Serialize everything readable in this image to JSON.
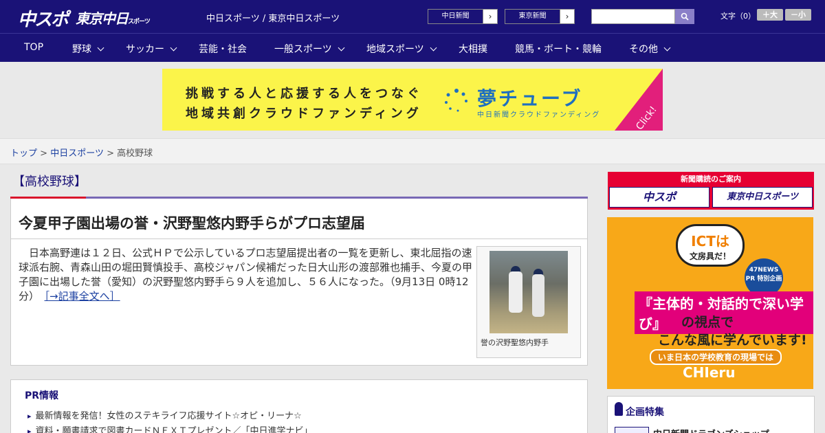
{
  "header": {
    "logo_chuspo": "中スポ",
    "logo_tokyo": "東京中日",
    "logo_tokyo_small": "スポーツ",
    "site_links": "中日スポーツ / 東京中日スポーツ",
    "paper_buttons": [
      "中日新聞",
      "東京新聞"
    ],
    "search_placeholder": "",
    "font_size_label": "文字（0）",
    "font_plus": "＋大",
    "font_minus": "－小"
  },
  "nav": {
    "items": [
      "TOP",
      "野球",
      "サッカー",
      "芸能・社会",
      "一般スポーツ",
      "地域スポーツ",
      "大相撲",
      "競馬・ボート・競輪",
      "その他"
    ]
  },
  "banner": {
    "line1": "挑戦する人と応援する人をつなぐ",
    "line2": "地域共創クラウドファンディング",
    "brand": "夢チューブ",
    "sub": "中日新聞クラウドファンディング",
    "click": "Click!"
  },
  "breadcrumb": {
    "home": "トップ",
    "section": "中日スポーツ",
    "current": "高校野球",
    "separator": ">"
  },
  "article": {
    "section_title": "【高校野球】",
    "headline": "今夏甲子園出場の誉・沢野聖悠内野手らがプロ志望届",
    "body": "日本高野連は１２日、公式ＨＰで公示しているプロ志望届提出者の一覧を更新し、東北屈指の速球派右腕、青森山田の堀田賢慎投手、高校ジャパン候補だった日大山形の渡部雅也捕手、今夏の甲子園に出場した誉（愛知）の沢野聖悠内野手ら９人を追加し、５６人になった。（9月13日 0時12分）",
    "more_link": "［→記事全文へ］",
    "photo_caption": "誉の沢野聖悠内野手"
  },
  "pr": {
    "title": "PR情報",
    "items": [
      "最新情報を発信！女性のステキライフ応援サイト☆オピ・リーナ☆",
      "資料・願書請求で図書カードＮＥＸＴプレゼント／「中日進学ナビ」"
    ]
  },
  "sidebar": {
    "subscribe_head": "新聞購読のご案内",
    "subscribe_buttons": [
      "中スポ",
      "東京中日スポーツ"
    ],
    "ad": {
      "bubble": "ICTは",
      "bubble_small": "文房具だ！",
      "badge": "47NEWS PR 特別企画",
      "main": "『主体的・対話的で深い学び』",
      "line2": "の視点で",
      "line3": "こんな風に学んでいます!",
      "line4": "いま日本の学校教育の現場では",
      "line5": "CHIeru"
    },
    "feature_title": "企画特集",
    "feature_item": "中日新聞ドラゴンズショップ"
  }
}
